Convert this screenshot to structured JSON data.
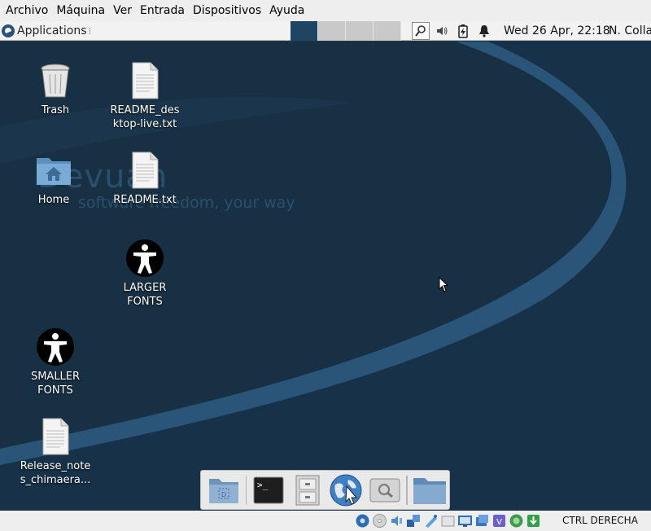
{
  "host_menu": [
    "Archivo",
    "Máquina",
    "Ver",
    "Entrada",
    "Dispositivos",
    "Ayuda"
  ],
  "panel": {
    "applications_label": "Applications",
    "grip": "⁝",
    "workspace_count": 4,
    "active_workspace": 1,
    "clock": "Wed 26 Apr, 22:18",
    "user": "N. Colla"
  },
  "desktop": {
    "watermark_logo": "Devuan",
    "watermark_tagline": "software freedom, your way",
    "icons": [
      {
        "id": "trash",
        "label": "Trash",
        "icon": "trash-icon"
      },
      {
        "id": "readme-desktop-live",
        "label": "README_des\nktop-live.txt",
        "icon": "text-file-icon"
      },
      {
        "id": "home",
        "label": "Home",
        "icon": "home-folder-icon"
      },
      {
        "id": "readme",
        "label": "README.txt",
        "icon": "text-file-icon"
      },
      {
        "id": "larger-fonts",
        "label": "LARGER\nFONTS",
        "icon": "accessibility-icon"
      },
      {
        "id": "smaller-fonts",
        "label": "SMALLER\nFONTS",
        "icon": "accessibility-icon"
      },
      {
        "id": "release-notes",
        "label": "Release_note\ns_chimaera...",
        "icon": "text-file-icon"
      }
    ]
  },
  "dock": [
    "show-desktop-icon",
    "terminal-icon",
    "file-manager-icon",
    "web-browser-icon",
    "app-finder-icon",
    "folder-icon"
  ],
  "statusbar": {
    "host_key": "CTRL DERECHA"
  },
  "colors": {
    "desktop_bg": "#183044",
    "wallpaper_arc": "#2a5478",
    "active_workspace": "#1e4563"
  }
}
